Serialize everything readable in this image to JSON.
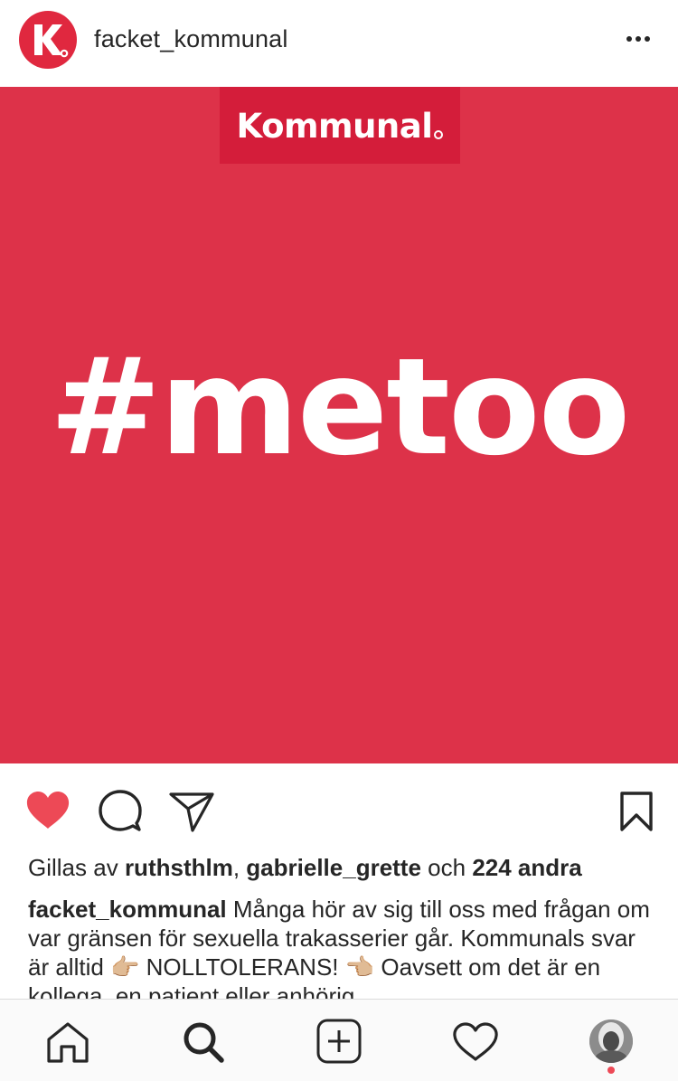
{
  "post": {
    "username": "facket_kommunal",
    "image": {
      "brand": "Kommunal",
      "hashtag": "#metoo",
      "background_color": "#dd3249",
      "brand_box_color": "#d41d3a"
    }
  },
  "actions": {
    "like_icon": "heart-filled-icon",
    "comment_icon": "comment-icon",
    "share_icon": "paper-plane-icon",
    "save_icon": "bookmark-icon",
    "liked": true,
    "like_color": "#ed4956"
  },
  "likes": {
    "prefix": "Gillas av",
    "user1": "ruthsthlm",
    "separator": ",",
    "user2": "gabrielle_grette",
    "conjunction": "och",
    "others": "224 andra"
  },
  "caption": {
    "username": "facket_kommunal",
    "text": "Många hör av sig till oss med frågan om var gränsen för sexuella trakasserier går. Kommunals svar är alltid 👉🏼 NOLLTOLERANS! 👈🏼 Oavsett om det är en kollega, en patient eller anhörig"
  },
  "tabbar": {
    "items": [
      "home-icon",
      "search-icon",
      "new-post-icon",
      "activity-heart-icon",
      "profile-avatar"
    ],
    "has_notification": true
  }
}
